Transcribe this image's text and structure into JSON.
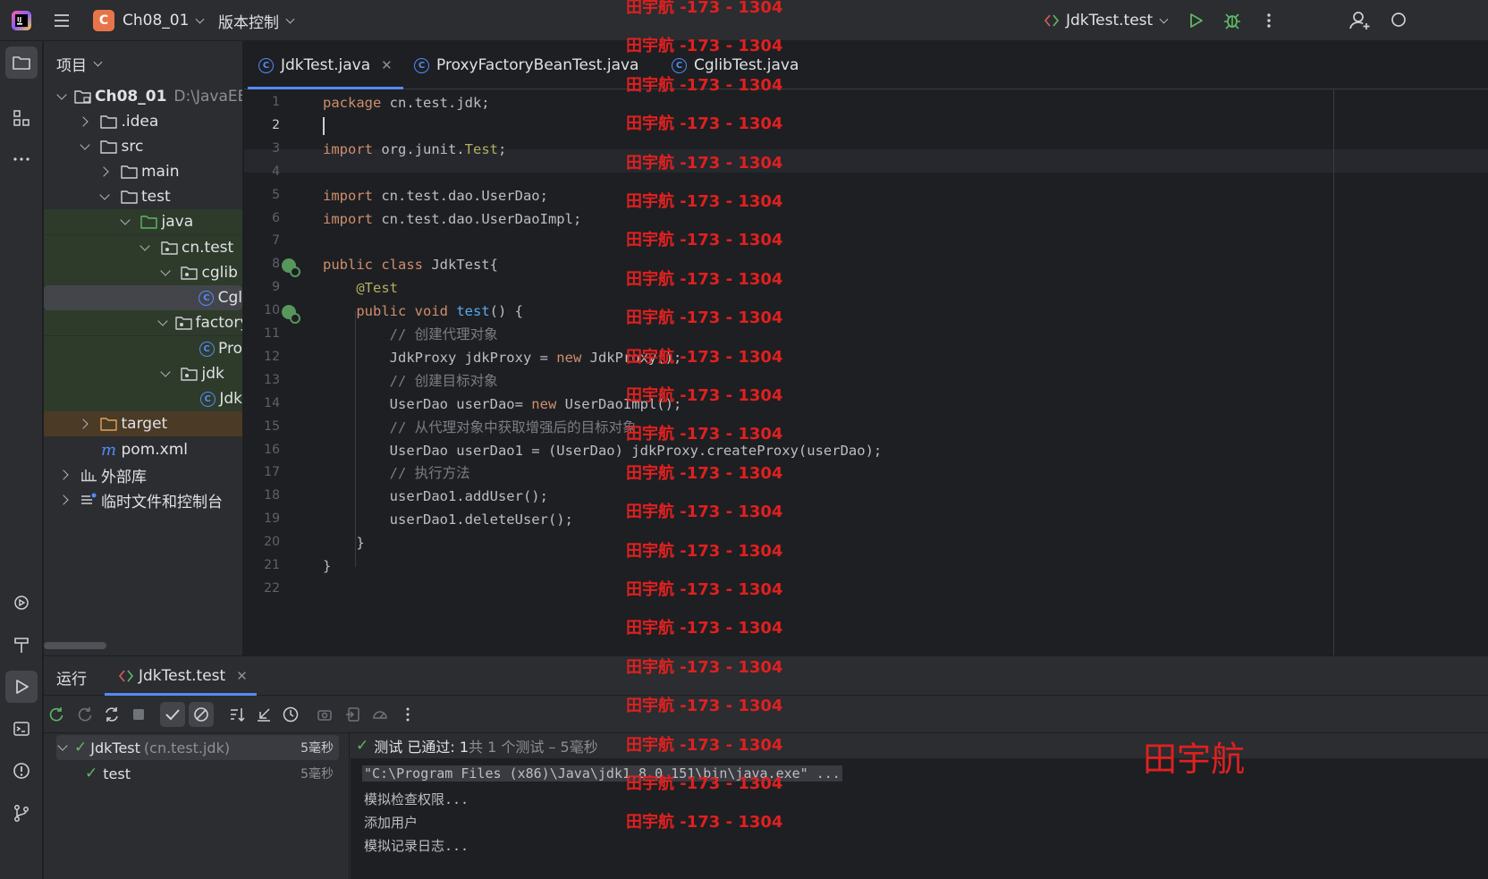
{
  "titlebar": {
    "project_badge": "C",
    "project_name": "Ch08_01",
    "vcs": "版本控制",
    "run_config": "JdkTest.test"
  },
  "project_panel": {
    "header": "项目",
    "tree": [
      {
        "label": "Ch08_01",
        "extra": "D:\\JavaEE",
        "type": "module",
        "state": "open",
        "depth": 0
      },
      {
        "label": ".idea",
        "type": "folder",
        "state": "closed",
        "depth": 1
      },
      {
        "label": "src",
        "type": "folder",
        "state": "open",
        "depth": 1
      },
      {
        "label": "main",
        "type": "folder",
        "state": "closed",
        "depth": 2
      },
      {
        "label": "test",
        "type": "folder",
        "state": "open",
        "depth": 2
      },
      {
        "label": "java",
        "type": "folder-green",
        "state": "open",
        "depth": 3
      },
      {
        "label": "cn.test",
        "type": "package",
        "state": "open",
        "depth": 4
      },
      {
        "label": "cglib",
        "type": "package",
        "state": "open",
        "depth": 5
      },
      {
        "label": "Cgl",
        "type": "class",
        "state": "none",
        "depth": 6
      },
      {
        "label": "factory",
        "type": "package",
        "state": "open",
        "depth": 5
      },
      {
        "label": "Pro",
        "type": "class",
        "state": "none",
        "depth": 6
      },
      {
        "label": "jdk",
        "type": "package",
        "state": "open",
        "depth": 5
      },
      {
        "label": "Jdk",
        "type": "class",
        "state": "none",
        "depth": 6
      },
      {
        "label": "target",
        "type": "folder-orange",
        "state": "closed",
        "depth": 1
      },
      {
        "label": "pom.xml",
        "type": "maven",
        "state": "none",
        "depth": 1
      },
      {
        "label": "外部库",
        "type": "library",
        "state": "closed",
        "depth": 0
      },
      {
        "label": "临时文件和控制台",
        "type": "scratch",
        "state": "closed",
        "depth": 0
      }
    ]
  },
  "editor": {
    "tabs": [
      {
        "label": "JdkTest.java",
        "active": true
      },
      {
        "label": "ProxyFactoryBeanTest.java",
        "active": false
      },
      {
        "label": "CglibTest.java",
        "active": false
      }
    ],
    "lines": [
      [
        [
          "kw",
          "package"
        ],
        [
          "t",
          " cn.test.jdk;"
        ]
      ],
      [],
      [
        [
          "kw",
          "import"
        ],
        [
          "t",
          " org.junit."
        ],
        [
          "an",
          "Test"
        ],
        [
          "t",
          ";"
        ]
      ],
      [],
      [
        [
          "kw",
          "import"
        ],
        [
          "t",
          " cn.test.dao.UserDao;"
        ]
      ],
      [
        [
          "kw",
          "import"
        ],
        [
          "t",
          " cn.test.dao.UserDaoImpl;"
        ]
      ],
      [],
      [
        [
          "kw",
          "public class"
        ],
        [
          "t",
          " JdkTest{"
        ]
      ],
      [
        [
          "t",
          "    "
        ],
        [
          "an",
          "@Test"
        ]
      ],
      [
        [
          "t",
          "    "
        ],
        [
          "kw",
          "public void"
        ],
        [
          "t",
          " "
        ],
        [
          "fn",
          "test"
        ],
        [
          "t",
          "() {"
        ]
      ],
      [
        [
          "t",
          "        "
        ],
        [
          "cm",
          "// 创建代理对象"
        ]
      ],
      [
        [
          "t",
          "        JdkProxy jdkProxy = "
        ],
        [
          "kw",
          "new"
        ],
        [
          "t",
          " JdkProxy();"
        ]
      ],
      [
        [
          "t",
          "        "
        ],
        [
          "cm",
          "// 创建目标对象"
        ]
      ],
      [
        [
          "t",
          "        UserDao userDao= "
        ],
        [
          "kw",
          "new"
        ],
        [
          "t",
          " UserDaoImpl();"
        ]
      ],
      [
        [
          "t",
          "        "
        ],
        [
          "cm",
          "// 从代理对象中获取增强后的目标对象"
        ]
      ],
      [
        [
          "t",
          "        UserDao userDao1 = (UserDao) jdkProxy.createProxy(userDao);"
        ]
      ],
      [
        [
          "t",
          "        "
        ],
        [
          "cm",
          "// 执行方法"
        ]
      ],
      [
        [
          "t",
          "        userDao1.addUser();"
        ]
      ],
      [
        [
          "t",
          "        userDao1.deleteUser();"
        ]
      ],
      [
        [
          "t",
          "    }"
        ]
      ],
      [
        [
          "t",
          "}"
        ]
      ],
      []
    ]
  },
  "run_panel": {
    "title": "运行",
    "tab": "JdkTest.test",
    "tests": [
      {
        "label": "JdkTest",
        "pkg": "(cn.test.jdk)",
        "time": "5毫秒"
      },
      {
        "label": "test",
        "pkg": "",
        "time": "5毫秒"
      }
    ],
    "status_prefix": "测试 已通过: 1",
    "status_suffix": "共 1 个测试 – 5毫秒",
    "console": [
      "\"C:\\Program Files (x86)\\Java\\jdk1.8.0_151\\bin\\java.exe\" ...",
      "模拟检查权限...",
      "添加用户",
      "模拟记录日志..."
    ]
  },
  "watermark": {
    "text": "田宇航 -173 - 1304",
    "big": "田宇航"
  },
  "colors": {
    "accent": "#548af7",
    "keyword": "#cf8e6d",
    "annotation": "#b3ae60",
    "function": "#56a8f5",
    "comment": "#7a7e85",
    "success": "#5fb865",
    "watermark": "#e02020"
  }
}
